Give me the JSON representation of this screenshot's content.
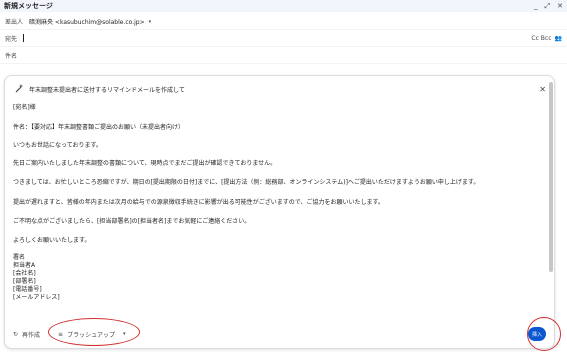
{
  "window": {
    "title": "新規メッセージ"
  },
  "from_row": {
    "label": "差出人",
    "sender": "暗渕麻央 <kasubuchim@solable.co.jp>"
  },
  "to_row": {
    "label": "宛先",
    "ccbcc": "Cc Bcc"
  },
  "subject_row": {
    "label": "件名"
  },
  "ai_panel": {
    "prompt": "年末調整未提出者に送付するリマインドメールを作成して",
    "body_lines": [
      "[宛名]様",
      "件名：【要対応】年末調整書類ご提出のお願い（未提出者向け）",
      "いつもお世話になっております。",
      "先日ご案内いたしました年末調整の書類について、現時点でまだご提出が確認できておりません。",
      "つきましては、お忙しいところ恐縮ですが、期日の[提出期限の日付]までに、[提出方法（例：総務部、オンラインシステム)]へご提出いただけますようお願い申し上げます。",
      "提出が遅れますと、皆様の年内または次月の給与での源泉徴収手続きに影響が出る可能性がございますので、ご協力をお願いいたします。",
      "ご不明な点がございましたら、[担当部署名]の[担当者名]までお気軽にご連絡ください。",
      "よろしくお願いいたします。",
      "署名",
      "担当者A",
      "[会社名]",
      "[部署名]",
      "[電話番号]",
      "[メールアドレス]"
    ],
    "retry_label": "再作成",
    "polish_label": "ブラッシュアップ",
    "insert_label": "挿入"
  },
  "icons": [
    "wand-icon",
    "close-icon",
    "refresh-icon",
    "filter-icon",
    "chevron-down-icon",
    "minimize-icon",
    "expand-icon",
    "contacts-icon"
  ],
  "colors": {
    "accent": "#0b57d0",
    "annotation": "#d32f2f"
  }
}
